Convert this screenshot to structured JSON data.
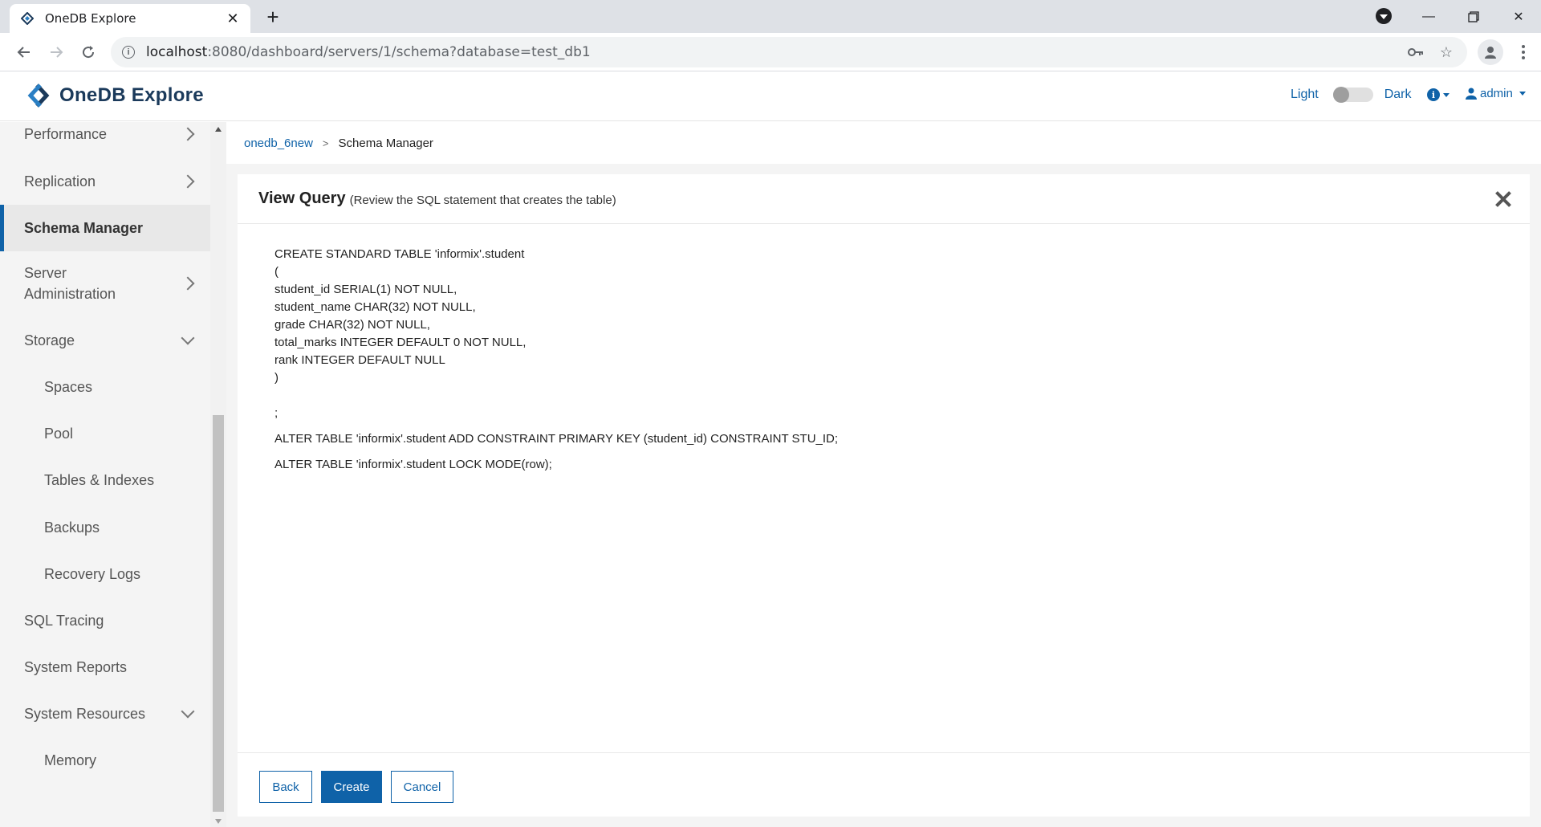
{
  "browser": {
    "tab_title": "OneDB Explore",
    "url_host": "localhost",
    "url_rest": ":8080/dashboard/servers/1/schema?database=test_db1"
  },
  "header": {
    "logo_text": "OneDB Explore",
    "theme_light": "Light",
    "theme_dark": "Dark",
    "user": "admin"
  },
  "sidebar": {
    "items": [
      {
        "label": "Performance"
      },
      {
        "label": "Replication"
      },
      {
        "label": "Schema Manager"
      },
      {
        "label": "Server\nAdministration"
      },
      {
        "label": "Storage"
      },
      {
        "label": "Spaces"
      },
      {
        "label": "Pool"
      },
      {
        "label": "Tables & Indexes"
      },
      {
        "label": "Backups"
      },
      {
        "label": "Recovery Logs"
      },
      {
        "label": "SQL Tracing"
      },
      {
        "label": "System Reports"
      },
      {
        "label": "System Resources"
      },
      {
        "label": "Memory"
      }
    ]
  },
  "breadcrumb": {
    "link": "onedb_6new",
    "separator": ">",
    "current": "Schema Manager"
  },
  "card": {
    "title": "View Query",
    "subtitle": "(Review the SQL statement that creates the table)",
    "sql": {
      "l1": "CREATE STANDARD TABLE 'informix'.student",
      "l2": "(",
      "l3": "student_id SERIAL(1) NOT NULL,",
      "l4": "student_name CHAR(32) NOT NULL,",
      "l5": "grade CHAR(32) NOT NULL,",
      "l6": "total_marks INTEGER DEFAULT 0 NOT NULL,",
      "l7": "rank INTEGER DEFAULT NULL",
      "l8": ")",
      "l9": ";",
      "l10": "ALTER TABLE 'informix'.student ADD CONSTRAINT PRIMARY KEY (student_id) CONSTRAINT STU_ID;",
      "l11": "ALTER TABLE 'informix'.student LOCK MODE(row);"
    },
    "buttons": {
      "back": "Back",
      "create": "Create",
      "cancel": "Cancel"
    }
  },
  "colors": {
    "accent": "#0f62a8",
    "sidebar_bg": "#f4f4f4"
  }
}
